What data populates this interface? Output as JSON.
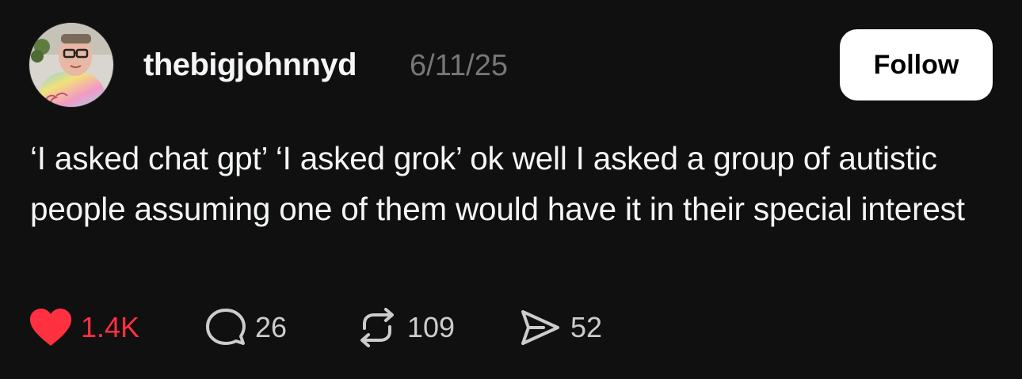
{
  "post": {
    "author": {
      "username": "thebigjohnnyd",
      "avatar_label": "avatar"
    },
    "date": "6/11/25",
    "follow_label": "Follow",
    "text": "‘I asked chat gpt’ ‘I asked grok’ ok well I asked a group of autistic people assuming one of them would have it in their special interest",
    "actions": {
      "likes": "1.4K",
      "replies": "26",
      "reposts": "109",
      "shares": "52"
    }
  },
  "colors": {
    "background": "#101010",
    "like_active": "#ff3040",
    "muted": "#777777",
    "follow_bg": "#ffffff"
  },
  "icons": {
    "like": "heart-filled-icon",
    "reply": "speech-bubble-icon",
    "repost": "repost-arrows-icon",
    "share": "paper-plane-icon"
  }
}
